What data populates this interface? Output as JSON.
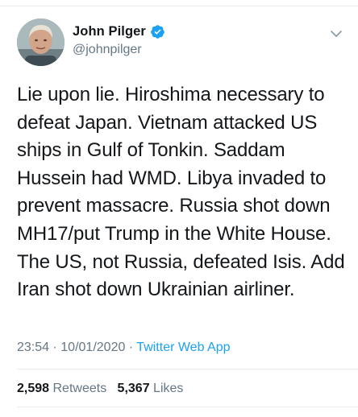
{
  "author": {
    "display_name": "John Pilger",
    "handle": "@johnpilger",
    "verified": true,
    "avatar_icon": "profile-photo"
  },
  "tweet": {
    "lines": [
      "Lie upon lie. Hiroshima necessary to",
      "defeat Japan. Vietnam attacked US",
      "ships in Gulf of Tonkin. Saddam",
      "Hussein had WMD. Libya invaded to",
      "prevent massacre. Russia shot down",
      "MH17/put Trump in the White House.",
      "The US, not Russia, defeated Isis. Add",
      "Iran shot down Ukrainian airliner."
    ],
    "time": "23:54",
    "date": "10/01/2020",
    "separator": "·",
    "source": "Twitter Web App"
  },
  "stats": {
    "retweets_count": "2,598",
    "retweets_label": "Retweets",
    "likes_count": "5,367",
    "likes_label": "Likes"
  },
  "colors": {
    "accent": "#1da1f2",
    "muted": "#657786",
    "text": "#14171a",
    "divider": "#e6ecf0"
  },
  "icons": {
    "verified": "verified-badge-icon",
    "menu": "chevron-down-icon"
  }
}
